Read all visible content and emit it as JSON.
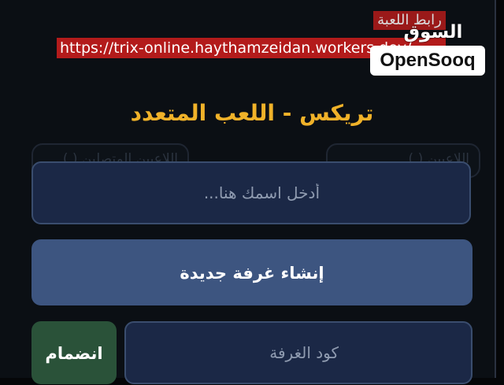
{
  "banner": {
    "label": "رابط اللعبة",
    "url": "https://trix-online.haythamzeidan.workers.dev/"
  },
  "watermark": {
    "arabic": "السوق المفتوح",
    "brand": "OpenSooq"
  },
  "page": {
    "title": "تريكس - اللعب المتعدد"
  },
  "background": {
    "left_card": "اللاعبين المتصلين ( )",
    "right_card": "اللاعبين ( )"
  },
  "form": {
    "name_placeholder": "أدخل اسمك هنا...",
    "create_label": "إنشاء غرفة جديدة",
    "room_code_placeholder": "كود الغرفة",
    "join_label": "انضمام"
  },
  "colors": {
    "title": "#f0b229",
    "create_button": "#3d5580",
    "join_button": "#2a5239",
    "input_bg": "#1b2846",
    "banner_highlight": "#b31b1b"
  }
}
